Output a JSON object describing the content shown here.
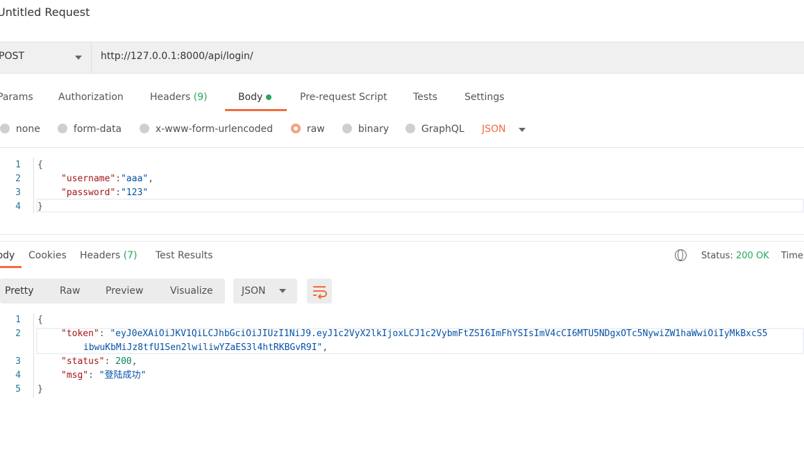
{
  "request": {
    "title": "Untitled Request",
    "method": "POST",
    "url": "http://127.0.0.1:8000/api/login/",
    "tabs": [
      {
        "label": "Params"
      },
      {
        "label": "Authorization"
      },
      {
        "label": "Headers",
        "count": "(9)"
      },
      {
        "label": "Body"
      },
      {
        "label": "Pre-request Script"
      },
      {
        "label": "Tests"
      },
      {
        "label": "Settings"
      }
    ],
    "body_types": [
      "none",
      "form-data",
      "x-www-form-urlencoded",
      "raw",
      "binary",
      "GraphQL"
    ],
    "selected_body_type": "raw",
    "format": "JSON",
    "editor_lines": [
      "{",
      "\"username\":\"aaa\",",
      "\"password\":\"123\"",
      "}"
    ],
    "line_numbers": [
      "1",
      "2",
      "3",
      "4"
    ],
    "body_line2": {
      "key": "\"username\"",
      "value": "\"aaa\""
    },
    "body_line3": {
      "key": "\"password\"",
      "value": "\"123\""
    }
  },
  "response": {
    "tabs": [
      {
        "label": "Body"
      },
      {
        "label": "Cookies"
      },
      {
        "label": "Headers",
        "count": "(7)"
      },
      {
        "label": "Test Results"
      }
    ],
    "status_label": "Status:",
    "status_value": "200 OK",
    "time_label": "Time",
    "view_modes": [
      "Pretty",
      "Raw",
      "Preview",
      "Visualize"
    ],
    "format": "JSON",
    "line_numbers": [
      "1",
      "2",
      "3",
      "4",
      "5"
    ],
    "token_key": "\"token\"",
    "token_value": "\"eyJ0eXAiOiJKV1QiLCJhbGciOiJIUzI1NiJ9.eyJ1c2VyX2lkIjoxLCJ1c2VybmFtZSI6ImFhYSIsImV4cCI6MTU5NDgxOTc5NywiZW1haWwiOiIyMkBxcS5",
    "token_cont": "ibwuKbMiJz8tfU1Sen2lwiliwYZaES3l4htRKBGvR9I\"",
    "status_key": "\"status\"",
    "status_val": "200",
    "msg_key": "\"msg\"",
    "msg_val": "\"登陆成功\""
  },
  "colors": {
    "accent": "#f26b3a",
    "success": "#26a65b"
  }
}
